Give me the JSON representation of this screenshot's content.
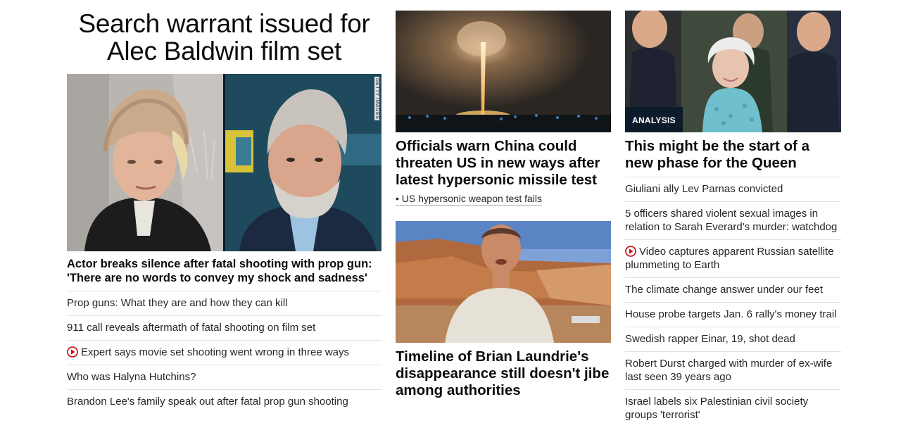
{
  "col1": {
    "headline": "Search warrant issued for Alec Baldwin film set",
    "image_credit": "GETTY IMAGES",
    "lead": "Actor breaks silence after fatal shooting with prop gun: 'There are no words to convey my shock and sadness'",
    "links": [
      {
        "text": "Prop guns: What they are and how they can kill",
        "video": false
      },
      {
        "text": "911 call reveals aftermath of fatal shooting on film set",
        "video": false
      },
      {
        "text": "Expert says movie set shooting went wrong in three ways",
        "video": true
      },
      {
        "text": "Who was Halyna Hutchins?",
        "video": false
      },
      {
        "text": "Brandon Lee's family speak out after fatal prop gun shooting",
        "video": false
      }
    ]
  },
  "col2": {
    "story1_headline": "Officials warn China could threaten US in new ways after latest hypersonic missile test",
    "story1_sublink": "• US hypersonic weapon test fails",
    "story2_headline": "Timeline of Brian Laundrie's disappearance still doesn't jibe among authorities"
  },
  "col3": {
    "badge": "ANALYSIS",
    "headline": "This might be the start of a new phase for the Queen",
    "links": [
      {
        "text": "Giuliani ally Lev Parnas convicted",
        "video": false
      },
      {
        "text": "5 officers shared violent sexual images in relation to Sarah Everard's murder: watchdog",
        "video": false
      },
      {
        "text": "Video captures apparent Russian satellite plummeting to Earth",
        "video": true
      },
      {
        "text": "The climate change answer under our feet",
        "video": false
      },
      {
        "text": "House probe targets Jan. 6 rally's money trail",
        "video": false
      },
      {
        "text": "Swedish rapper Einar, 19, shot dead",
        "video": false
      },
      {
        "text": "Robert Durst charged with murder of ex-wife last seen 39 years ago",
        "video": false
      },
      {
        "text": "Israel labels six Palestinian civil society groups 'terrorist'",
        "video": false
      }
    ]
  },
  "colors": {
    "video_icon": "#cc0000",
    "badge_bg": "#0c1b2a",
    "divider": "#e0e0e0"
  },
  "icons": {
    "video": "play-circle-icon"
  }
}
